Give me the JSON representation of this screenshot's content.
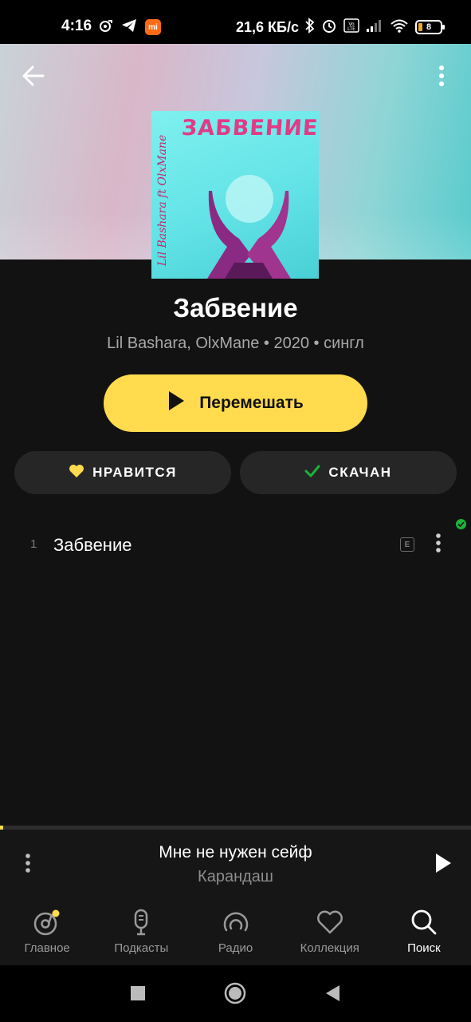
{
  "status_bar": {
    "time": "4:16",
    "network_speed": "21,6 КБ/с",
    "mi_badge": "mi",
    "battery": "8",
    "volte": "Vo LTE"
  },
  "header": {
    "back_icon": "arrow-left-icon",
    "more_icon": "vertical-dots-icon"
  },
  "cover": {
    "title_text": "ЗАБВЕНИЕ",
    "side_text": "Lil Bashara ft OlxMane",
    "colors": {
      "bg": "#63e3e6",
      "text": "#e23a86"
    }
  },
  "album": {
    "title": "Забвение",
    "meta": "Lil Bashara, OlxMane • 2020 • сингл"
  },
  "actions": {
    "shuffle_label": "Перемешать",
    "like_label": "НРАВИТСЯ",
    "downloaded_label": "СКАЧАН",
    "accent": "#ffdb4d",
    "like_color": "#ffdb4d",
    "check_color": "#1db33a"
  },
  "tracks": [
    {
      "number": "1",
      "title": "Забвение",
      "explicit": "E",
      "downloaded": true
    }
  ],
  "mini_player": {
    "title": "Мне не нужен сейф",
    "artist": "Карандаш",
    "progress": 0.006
  },
  "nav": {
    "items": [
      {
        "label": "Главное",
        "icon": "home-music-icon",
        "active": false
      },
      {
        "label": "Подкасты",
        "icon": "microphone-icon",
        "active": false
      },
      {
        "label": "Радио",
        "icon": "radio-icon",
        "active": false
      },
      {
        "label": "Коллекция",
        "icon": "heart-icon",
        "active": false
      },
      {
        "label": "Поиск",
        "icon": "search-icon",
        "active": true
      }
    ]
  },
  "system_nav": {
    "recents_icon": "square-icon",
    "home_icon": "circle-icon",
    "back_icon": "triangle-back-icon"
  }
}
